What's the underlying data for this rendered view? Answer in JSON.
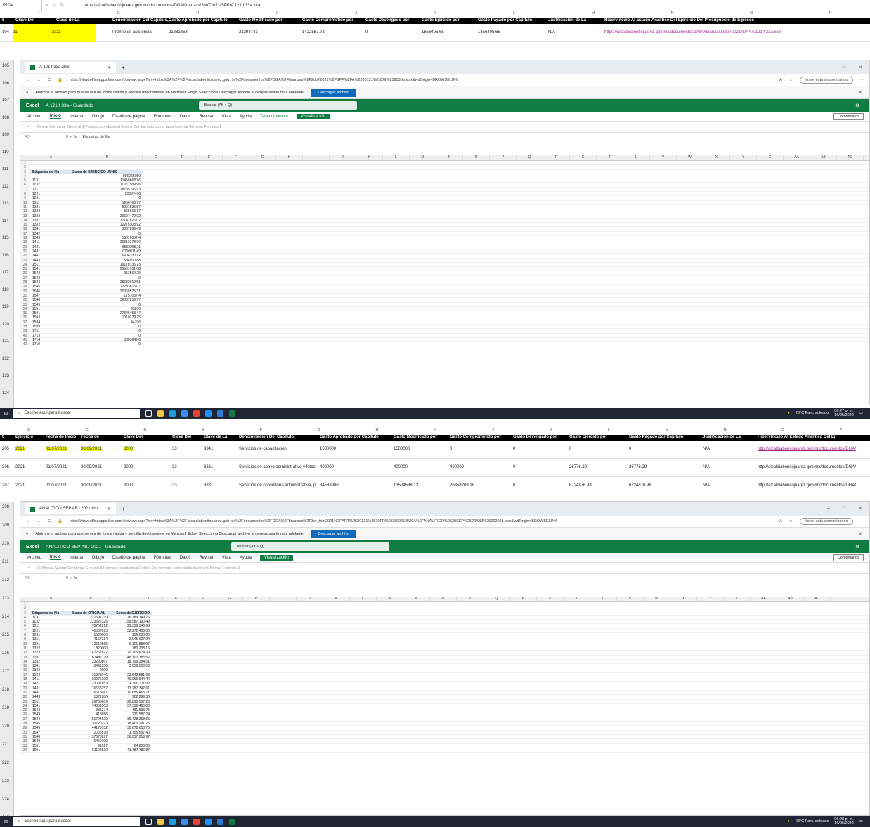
{
  "top": {
    "cell_ref": "P104",
    "formula": "https://alcaldiabenitojuarez.gob.mx/documentos/DGA/finanzas/2doT2021/SPP/A 121 f 33a.xlsx",
    "col_letters": [
      "F",
      "G",
      "H",
      "I",
      "J",
      "K",
      "L",
      "M",
      "N",
      "O",
      "P"
    ],
    "header_row_num": "6",
    "headers": [
      "Clave Del",
      "Clave de La",
      "Denominación Del Capitulo,",
      "Gasto Aprobado por Capitulo,",
      "Gasto Modificado por",
      "Gasto Comprometido por",
      "Gasto Devengado por",
      "Gasto Ejercido por",
      "Gasto Pagado por Capitulo,",
      "Justificación de La",
      "Hipervínculo Al Estado Analítico Del Ejercicio Del Presupuesto de Egresos"
    ],
    "data_row_num": "104",
    "data_row": [
      "21",
      "2111",
      "Premio de asistencia.",
      "21881853",
      "21394743",
      "1422557.72",
      "0",
      "1856405.65",
      "1856405.65",
      "N/A",
      "https://alcaldiabenitojuarez.gob.mx/documentos/DGA/finanzas/2doT2021/SPP/A 121 f 33a.xlsx"
    ],
    "left_row_nums": [
      "105",
      "106",
      "107",
      "108",
      "109",
      "110",
      "111",
      "112",
      "113",
      "114",
      "115",
      "116",
      "117",
      "118",
      "119",
      "120",
      "121",
      "122",
      "123",
      "124"
    ],
    "browser": {
      "tab_title": "A 121 f 33a.xlsx",
      "url": "https://view.officeapps.live.com/op/view.aspx?src=https%3A%2F%2Falcaldiabenitojuarez.gob.mx%2Fdocumentos%2FDGA%2Ffinanzas%2F2doT2021%2FSPP%2FA%2520121%2520f%252033a.xlsx&wdOrigin=BROWSELINK",
      "sync": "No se está sincronizando",
      "info": "Abrimos el archivo para que se vea de forma rápida y sencilla directamente en Microsoft Edge. Selecciona Descargar archivo si deseas usarlo más adelante.",
      "download": "Descargar archivo"
    },
    "excel": {
      "app": "Excel",
      "doc": "A 121 f 33a  -  Guardado",
      "search": "Buscar (Alt + Q)",
      "menu": [
        "Archivo",
        "Inicio",
        "Insertar",
        "Dibujo",
        "Diseño de página",
        "Fórmulas",
        "Datos",
        "Revisar",
        "Vista",
        "Ayuda",
        "Tabla dinámica"
      ],
      "vis": "Visualización",
      "comments": "Comentarios",
      "ribbon": "Alinear   Combinar   General   $   Formato condicional   Estilos   Dar formato como tabla   Insertar   Eliminar   Formato   Σ",
      "name_box": "A3",
      "formula": "Etiquetas de fila",
      "cols": [
        "A",
        "B",
        "C",
        "D",
        "E",
        "F",
        "G",
        "H",
        "I",
        "J",
        "K",
        "L",
        "M",
        "N",
        "O",
        "P",
        "Q",
        "R",
        "S",
        "T",
        "U",
        "V",
        "W",
        "X",
        "Y",
        "Z",
        "AA",
        "AB",
        "AC"
      ],
      "rows": [
        [
          "1",
          "",
          ""
        ],
        [
          "2",
          "",
          ""
        ],
        [
          "3",
          "Etiquetas de fila",
          "Suma de EJERCIDO JUNIO"
        ],
        [
          "4",
          "",
          "886965059"
        ],
        [
          "5",
          "1131",
          "114586680,6"
        ],
        [
          "6",
          "1132",
          "102115895,6"
        ],
        [
          "7",
          "1211",
          "28135196,93"
        ],
        [
          "8",
          "1221",
          "20887476"
        ],
        [
          "9",
          "1231",
          "0"
        ],
        [
          "10",
          "1311",
          "1956765,97"
        ],
        [
          "11",
          "1321",
          "5921535,57"
        ],
        [
          "12",
          "1322",
          "555513,17"
        ],
        [
          "13",
          "1323",
          "29697472,92"
        ],
        [
          "14",
          "1331",
          "32141626,02"
        ],
        [
          "15",
          "1332",
          "12275308,92"
        ],
        [
          "16",
          "1341",
          "3037269,49"
        ],
        [
          "17",
          "1342",
          "0"
        ],
        [
          "18",
          "1343",
          "15316532,4"
        ],
        [
          "19",
          "1411",
          "26512278,06"
        ],
        [
          "20",
          "1421",
          "8563265,11"
        ],
        [
          "21",
          "1431",
          "6700811,49"
        ],
        [
          "22",
          "1441",
          "6904330,12"
        ],
        [
          "23",
          "1443",
          "584500,88"
        ],
        [
          "24",
          "1511",
          "19170135,73"
        ],
        [
          "25",
          "1541",
          "29581931,08"
        ],
        [
          "26",
          "1542",
          "353564,25"
        ],
        [
          "27",
          "1543",
          "0"
        ],
        [
          "28",
          "1544",
          "25632012,51"
        ],
        [
          "29",
          "1545",
          "12283615,07"
        ],
        [
          "30",
          "1546",
          "20369575,31"
        ],
        [
          "31",
          "1547",
          "1757057,4"
        ],
        [
          "32",
          "1548",
          "36037219,97"
        ],
        [
          "33",
          "1549",
          "0"
        ],
        [
          "34",
          "1551",
          "43200"
        ],
        [
          "35",
          "1591",
          "27546453,47"
        ],
        [
          "36",
          "1593",
          "1010279,25"
        ],
        [
          "37",
          "1594",
          "44796"
        ],
        [
          "38",
          "1599",
          "0"
        ],
        [
          "39",
          "1711",
          "0"
        ],
        [
          "40",
          "1713",
          "0"
        ],
        [
          "41",
          "1714",
          "3803649,6"
        ],
        [
          "42",
          "1719",
          "0"
        ]
      ]
    },
    "taskbar": {
      "search": "Escribe aquí para buscar",
      "weather": "28°C  Parc. soleado",
      "time": "06:27 p. m.",
      "date": "16/05/2022"
    }
  },
  "bottom": {
    "col_letters": [
      "B",
      "C",
      "D",
      "E",
      "F",
      "G",
      "H",
      "I",
      "J",
      "K",
      "L",
      "M",
      "N",
      "O",
      "P"
    ],
    "header_row_num": "6",
    "headers": [
      "Ejercicio",
      "Fecha de Inicio",
      "Fecha de",
      "Clave Del",
      "Clave Del",
      "Clave de La",
      "Denominación Del Capitulo,",
      "Gasto Aprobado por Capitulo,",
      "Gasto Modificado por",
      "Gasto Comprometido por",
      "Gasto Devengado por",
      "Gasto Ejercido por",
      "Gasto Pagado por Capitulo,",
      "Justificación de La",
      "Hipervínculo Al Estado Analítico Del Ej"
    ],
    "rows": [
      {
        "num": "205",
        "v": [
          "2021",
          "01/07/2021",
          "30/09/2021",
          "3000",
          "33",
          "3341",
          "Servicios de capacitación",
          "1500000",
          "1500000",
          "0",
          "0",
          "0",
          "0",
          "N/A",
          "http://alcaldiabenitojuarez.gob.mx/documentos/DGA/"
        ]
      },
      {
        "num": "206",
        "v": [
          "2021",
          "01/07/2021",
          "30/09/2021",
          "3000",
          "33",
          "3361",
          "Servicios de apoyo administrativo y fotoc",
          "400000",
          "400000",
          "400000",
          "0",
          "26776.29",
          "26776.29",
          "N/A",
          "http://alcaldiabenitojuarez.gob.mx/documentos/DGA/"
        ]
      },
      {
        "num": "207",
        "v": [
          "2021",
          "01/07/2021",
          "30/09/2021",
          "3000",
          "33",
          "3331",
          "Servicios de consultoría administrativa, p",
          "34533986",
          "13524588.13",
          "26358209.18",
          "0",
          "6724876.98",
          "6724876.98",
          "N/A",
          "http://alcaldiabenitojuarez.gob.mx/documentos/DGA/"
        ]
      }
    ],
    "left_row_nums": [
      "208",
      "209",
      "210",
      "211",
      "212",
      "213",
      "214",
      "215",
      "216",
      "217",
      "218",
      "219",
      "220",
      "221",
      "222",
      "223",
      "224",
      "225"
    ],
    "browser": {
      "tab_title": "ANALITICO SEP ABJ 2021.xlsx",
      "url": "https://view.officeapps.live.com/op/view.aspx?src=https%3A%2F%2Falcaldiabenitojuarez.gob.mx%2Fdocumentos%2FDGA%2Ffinanzas%2F3er_trim2021%2FART%2520121%2520FR%252033%2520A%2FANALITICO%2520SEP%2520ABJ%25202021.xlsx&wdOrigin=BROWSELINK",
      "sync": "No se está sincronizando",
      "info": "Abrimos el archivo para que se vea de forma rápida y sencilla directamente en Microsoft Edge. Selecciona Descargar archivo si deseas usarlo más adelante.",
      "download": "Descargar archivo"
    },
    "excel": {
      "app": "Excel",
      "doc": "ANALITICO SEP ABJ 2021  -  Guardado",
      "search": "Buscar (Alt + Q)",
      "menu": [
        "Archivo",
        "Inicio",
        "Insertar",
        "Dibujo",
        "Diseño de página",
        "Fórmulas",
        "Datos",
        "Revisar",
        "Vista",
        "Ayuda"
      ],
      "vis": "Visualización",
      "comments": "Comentarios",
      "ribbon": "12   Alinear   Ajustar   Combinar   General   $   Formato condicional   Estilos   Dar formato como tabla   Insertar   Eliminar   Formato   Σ",
      "name_box": "A1",
      "formula": "",
      "cols": [
        "A",
        "B",
        "C",
        "D",
        "E",
        "F",
        "G",
        "H",
        "I",
        "J",
        "K",
        "L",
        "M",
        "N",
        "O",
        "P",
        "Q",
        "R",
        "S",
        "T",
        "U",
        "V",
        "W",
        "X",
        "Y",
        "Z",
        "AA",
        "AB",
        "AC"
      ],
      "rows": [
        [
          "1",
          "",
          ""
        ],
        [
          "2",
          "",
          ""
        ],
        [
          "3",
          "Etiquetas de fila",
          "Suma de ORIGINAL",
          "Suma de EJERCIDO"
        ],
        [
          "4",
          "1131",
          "227591239",
          "176.789.349,76"
        ],
        [
          "5",
          "1132",
          "223322325",
          "158.587.190,49"
        ],
        [
          "6",
          "1211",
          "78752212",
          "29.338.346,93"
        ],
        [
          "7",
          "1221",
          "40587693",
          "32.272.436,00"
        ],
        [
          "8",
          "1231",
          "1500000",
          "156.000,00"
        ],
        [
          "9",
          "1311",
          "4167214",
          "2.945.627,04"
        ],
        [
          "10",
          "1321",
          "12612565",
          "6.101.888,07"
        ],
        [
          "11",
          "1322",
          "820000",
          "780.238,16"
        ],
        [
          "12",
          "1323",
          "47251822",
          "29.705.674,39"
        ],
        [
          "13",
          "1331",
          "61487119",
          "48.100.385,52"
        ],
        [
          "14",
          "1332",
          "23290867",
          "18.799.284,51"
        ],
        [
          "15",
          "1341",
          "3491550",
          "3.039.556,58"
        ],
        [
          "16",
          "1342",
          "2000",
          ""
        ],
        [
          "17",
          "1343",
          "31973046",
          "23.642.581,68"
        ],
        [
          "18",
          "1411",
          "60975399",
          "40.966.944,44"
        ],
        [
          "19",
          "1421",
          "23097653",
          "14.906.111,90"
        ],
        [
          "20",
          "1431",
          "16658757",
          "13.287.347,61"
        ],
        [
          "21",
          "1441",
          "16675047",
          "10.685.465,71"
        ],
        [
          "22",
          "1443",
          "1871286",
          "902.299,30"
        ],
        [
          "23",
          "1511",
          "29738809",
          "28.890.557,28"
        ],
        [
          "24",
          "1541",
          "74351303",
          "37.338.485,08"
        ],
        [
          "25",
          "1542",
          "381374",
          "481.533,75"
        ],
        [
          "26",
          "1543",
          "413656",
          "221.587,24"
        ],
        [
          "27",
          "1544",
          "51724829",
          "39.428.358,65"
        ],
        [
          "28",
          "1545",
          "30720723",
          "18.403.291,26"
        ],
        [
          "29",
          "1546",
          "44170732",
          "30.678.658,70"
        ],
        [
          "30",
          "1547",
          "2005578",
          "1.755.557,40"
        ],
        [
          "31",
          "1548",
          "37678297",
          "36.037.219,97"
        ],
        [
          "32",
          "1549",
          "6450199",
          ""
        ],
        [
          "33",
          "1551",
          "91027",
          "64.800,00"
        ],
        [
          "34",
          "1591",
          "51128620",
          "41.787.786,87"
        ]
      ]
    },
    "taskbar": {
      "search": "Escribe aquí para buscar",
      "weather": "28°C  Parc. soleado",
      "time": "06:28 p. m.",
      "date": "16/05/2022"
    }
  }
}
